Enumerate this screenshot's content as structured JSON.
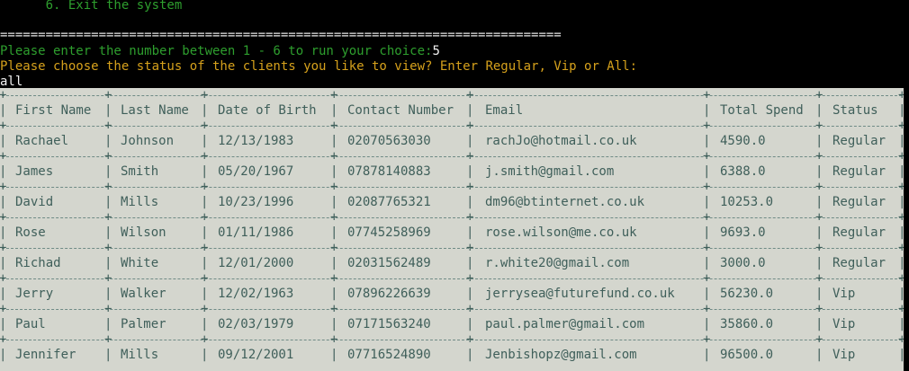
{
  "terminal": {
    "menu_last_item": "      6. Exit the system",
    "separator": "==========================================================================",
    "prompt_choice": "Please enter the number between 1 - 6 to run your choice:",
    "choice_value": "5",
    "prompt_status": "Please choose the status of the clients you like to view? Enter Regular, Vip or All:",
    "status_input": "all"
  },
  "table": {
    "headers": [
      "First Name",
      "Last Name",
      "Date of Birth",
      "Contact Number",
      "Email",
      "Total Spend",
      "Status"
    ],
    "rows": [
      [
        "Rachael",
        "Johnson",
        "12/13/1983",
        "02070563030",
        "rachJo@hotmail.co.uk",
        "4590.0",
        "Regular"
      ],
      [
        "James",
        "Smith",
        "05/20/1967",
        "07878140883",
        "j.smith@gmail.com",
        "6388.0",
        "Regular"
      ],
      [
        "David",
        "Mills",
        "10/23/1996",
        "02087765321",
        "dm96@btinternet.co.uk",
        "10253.0",
        "Regular"
      ],
      [
        "Rose",
        "Wilson",
        "01/11/1986",
        "07745258969",
        "rose.wilson@me.co.uk",
        "9693.0",
        "Regular"
      ],
      [
        "Richad",
        "White",
        "12/01/2000",
        "02031562489",
        "r.white20@gmail.com",
        "3000.0",
        "Regular"
      ],
      [
        "Jerry",
        "Walker",
        "12/02/1963",
        "07896226639",
        "jerrysea@futurefund.co.uk",
        "56230.0",
        "Vip"
      ],
      [
        "Paul",
        "Palmer",
        "02/03/1979",
        "07171563240",
        "paul.palmer@gmail.com",
        "35860.0",
        "Vip"
      ],
      [
        "Jennifer",
        "Mills",
        "09/12/2001",
        "07716524890",
        "Jenbishopz@gmail.com",
        "96500.0",
        "Vip"
      ]
    ]
  },
  "colors": {
    "terminal_bg": "#000000",
    "menu_text": "#2e9f2e",
    "prompt_text": "#d6a11c",
    "input_text": "#f2f2f2",
    "table_bg": "#d4d6ce",
    "table_text": "#3f5f5a"
  }
}
